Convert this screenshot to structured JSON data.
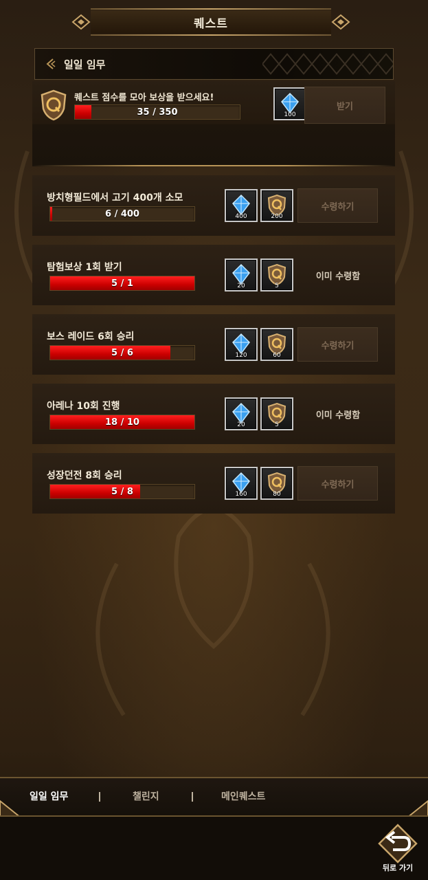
{
  "header": {
    "title": "퀘스트"
  },
  "section": {
    "label": "일일 임무"
  },
  "score": {
    "message": "퀘스트 점수를 모아 보상을 받으세요!",
    "progress_text": "35 / 350",
    "progress": 0.1,
    "reward_qty": "100",
    "claim_label": "받기"
  },
  "quests": [
    {
      "title": "방치형필드에서 고기 400개 소모",
      "progress_text": "6 / 400",
      "progress": 0.015,
      "gem_qty": "400",
      "point_qty": "200",
      "action": "수령하기",
      "claimed": false
    },
    {
      "title": "탐험보상 1회 받기",
      "progress_text": "5 / 1",
      "progress": 1.0,
      "gem_qty": "20",
      "point_qty": "5",
      "action": "이미 수령함",
      "claimed": true
    },
    {
      "title": "보스 레이드 6회 승리",
      "progress_text": "5 / 6",
      "progress": 0.833,
      "gem_qty": "120",
      "point_qty": "60",
      "action": "수령하기",
      "claimed": false
    },
    {
      "title": "아레나 10회 진행",
      "progress_text": "18 / 10",
      "progress": 1.0,
      "gem_qty": "20",
      "point_qty": "5",
      "action": "이미 수령함",
      "claimed": true
    },
    {
      "title": "성장던전 8회 승리",
      "progress_text": "5 / 8",
      "progress": 0.625,
      "gem_qty": "160",
      "point_qty": "80",
      "action": "수령하기",
      "claimed": false
    }
  ],
  "tabs": [
    {
      "label": "일일 임무",
      "active": true
    },
    {
      "label": "챌린지",
      "active": false
    },
    {
      "label": "메인퀘스트",
      "active": false
    }
  ],
  "back": {
    "label": "뒤로 가기"
  },
  "colors": {
    "progress_red": "#e00000",
    "gold": "#b89457",
    "panel": "#2a1f13"
  }
}
